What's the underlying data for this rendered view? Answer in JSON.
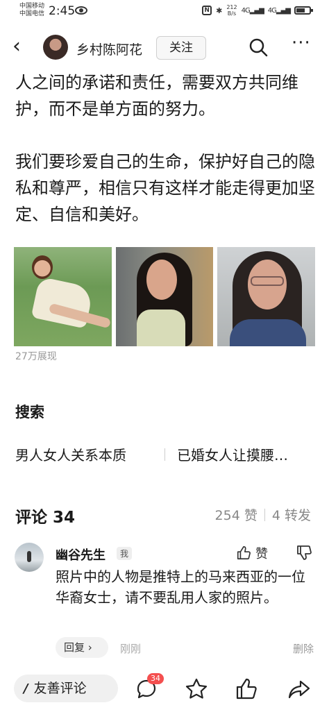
{
  "status_bar": {
    "carrier_1": "中国移动",
    "carrier_2": "中国电信",
    "time": "2:45",
    "speed_value": "212",
    "speed_unit": "B/s",
    "signal_1": "4G",
    "signal_2": "4G"
  },
  "header": {
    "author_name": "乡村陈阿花",
    "follow_label": "关注"
  },
  "article": {
    "paragraph_1": "人之间的承诺和责任，需要双方共同维护，而不是单方面的努力。",
    "paragraph_2": "我们要珍爱自己的生命，保护好自己的隐私和尊严，相信只有这样才能走得更加坚定、自信和美好。"
  },
  "photos": {
    "count": 3
  },
  "views": "27万展现",
  "search": {
    "title": "搜索",
    "items": [
      "男人女人关系本质",
      "已婚女人让摸腰…"
    ]
  },
  "comments": {
    "title": "评论 34",
    "likes": "254 赞",
    "shares": "4 转发"
  },
  "comment": {
    "name": "幽谷先生",
    "me_badge": "我",
    "like_label": "赞",
    "text": "照片中的人物是推特上的马来西亚的一位华裔女士，请不要乱用人家的照片。",
    "reply_label": "回复 ›",
    "time": "刚刚",
    "delete_label": "删除"
  },
  "bottom_bar": {
    "comment_button_label": "友善评论",
    "comment_badge": "34"
  },
  "icons": {
    "back": "back-arrow-icon",
    "search": "search-icon",
    "more": "more-icon",
    "like": "thumbs-up-icon",
    "dislike": "thumbs-down-icon",
    "comment": "comment-bubble-icon",
    "favorite": "star-icon",
    "upvote": "thumbs-up-icon",
    "share": "share-icon"
  }
}
